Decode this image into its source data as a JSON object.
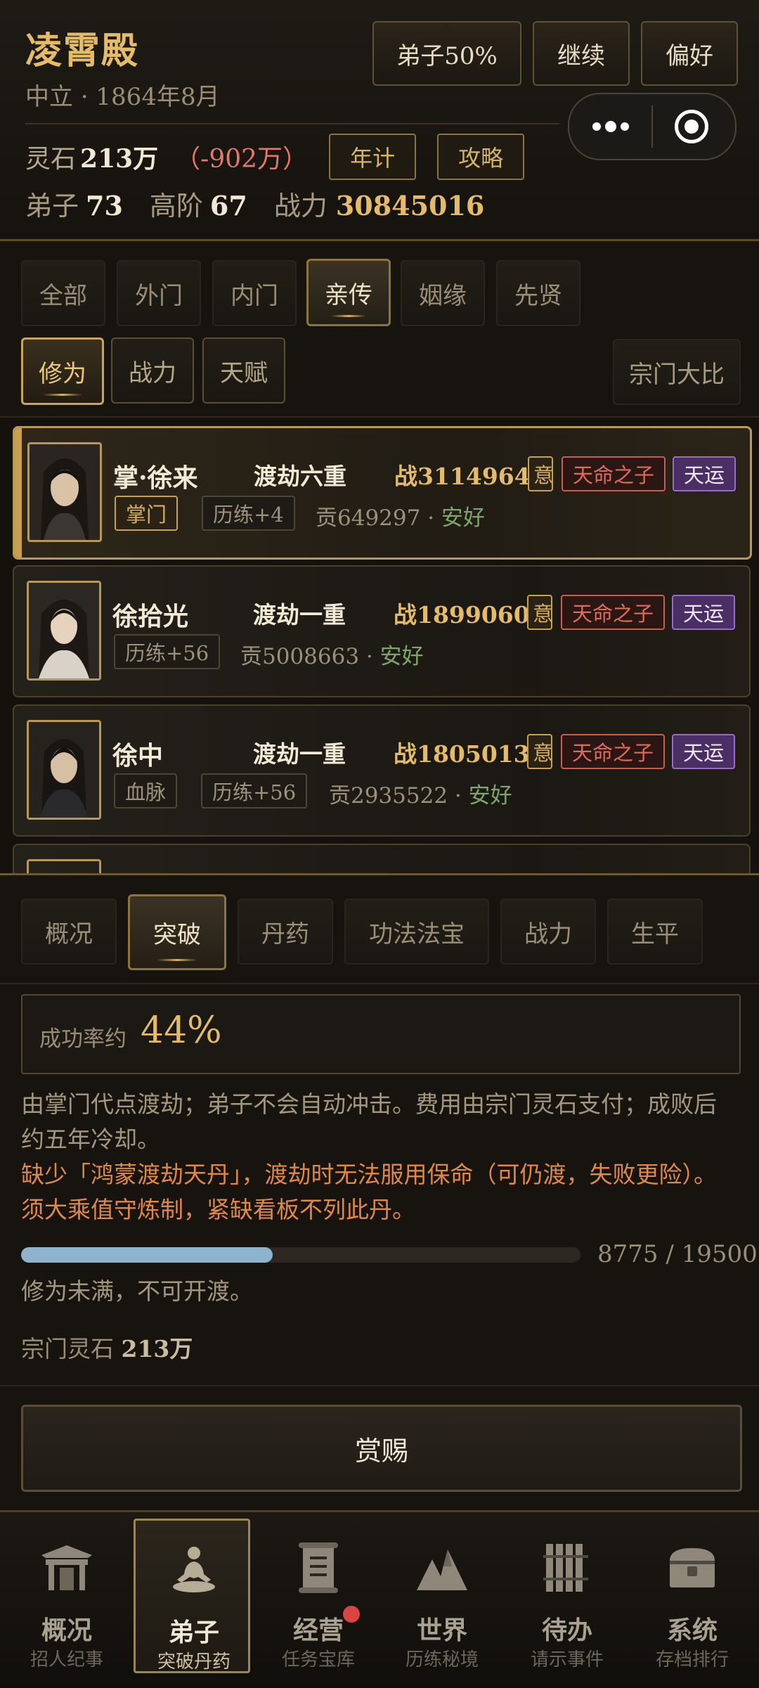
{
  "header": {
    "title": "凌霄殿",
    "subtitle": "中立 · 1864年8月",
    "buttons": [
      "弟子50%",
      "继续",
      "偏好"
    ],
    "spirit_label": "灵石",
    "spirit_value": "213万",
    "spirit_delta": "（-902万）",
    "btn_yearly": "年计",
    "btn_guide": "攻略",
    "disciples_label": "弟子",
    "disciples_value": "73",
    "high_label": "高阶",
    "high_value": "67",
    "power_label": "战力",
    "power_value": "30845016"
  },
  "tabs": [
    "全部",
    "外门",
    "内门",
    "亲传",
    "姻缘",
    "先贤"
  ],
  "active_tab": "亲传",
  "sort_tabs": [
    "修为",
    "战力",
    "天赋"
  ],
  "active_sort": "修为",
  "compare_button": "宗门大比",
  "disciples": [
    {
      "name": "掌·徐来",
      "realm": "渡劫六重",
      "power": "战3114964",
      "tag1": "掌门",
      "tag2": "历练+4",
      "contrib": "贡649297",
      "status": "安好",
      "badge_gold": "意",
      "badge_red": "天命之子",
      "badge_purple": "天运"
    },
    {
      "name": "徐拾光",
      "realm": "渡劫一重",
      "power": "战1899060",
      "tag1": "历练+56",
      "contrib": "贡5008663",
      "status": "安好",
      "badge_gold": "意",
      "badge_red": "天命之子",
      "badge_purple": "天运"
    },
    {
      "name": "徐中",
      "realm": "渡劫一重",
      "power": "战1805013",
      "tag1": "血脉",
      "tag2": "历练+56",
      "contrib": "贡2935522",
      "status": "安好",
      "badge_gold": "意",
      "badge_red": "天命之子",
      "badge_purple": "天运"
    }
  ],
  "detail_tabs": [
    "概况",
    "突破",
    "丹药",
    "功法法宝",
    "战力",
    "生平"
  ],
  "active_detail_tab": "突破",
  "breakthrough": {
    "rate_label": "成功率约",
    "rate_value": "44%",
    "desc1": "由掌门代点渡劫；弟子不会自动冲击。费用由宗门灵石支付；成败后约五年冷却。",
    "warning": "缺少「鸿蒙渡劫天丹」，渡劫时无法服用保命（可仍渡，失败更险）。须大乘值守炼制，紧缺看板不列此丹。",
    "progress_current": 8775,
    "progress_max": 19500,
    "progress_text": "8775 / 19500",
    "progress_note": "修为未满，不可开渡。",
    "sect_spirit_label": "宗门灵石",
    "sect_spirit_value": "213万",
    "reward_button": "赏赐"
  },
  "nav": [
    {
      "label": "概况",
      "sub": "招人纪事",
      "icon": "gate-icon"
    },
    {
      "label": "弟子",
      "sub": "突破丹药",
      "icon": "meditation-icon"
    },
    {
      "label": "经营",
      "sub": "任务宝库",
      "icon": "scroll-icon"
    },
    {
      "label": "世界",
      "sub": "历练秘境",
      "icon": "mountain-icon"
    },
    {
      "label": "待办",
      "sub": "请示事件",
      "icon": "bamboo-slips-icon"
    },
    {
      "label": "系统",
      "sub": "存档排行",
      "icon": "chest-icon"
    }
  ],
  "colors": {
    "gold": "#e3bb6a",
    "red": "#e06b5c",
    "purple": "#4a2f64",
    "green": "#7ea66b",
    "progress": "#8db3cf"
  }
}
